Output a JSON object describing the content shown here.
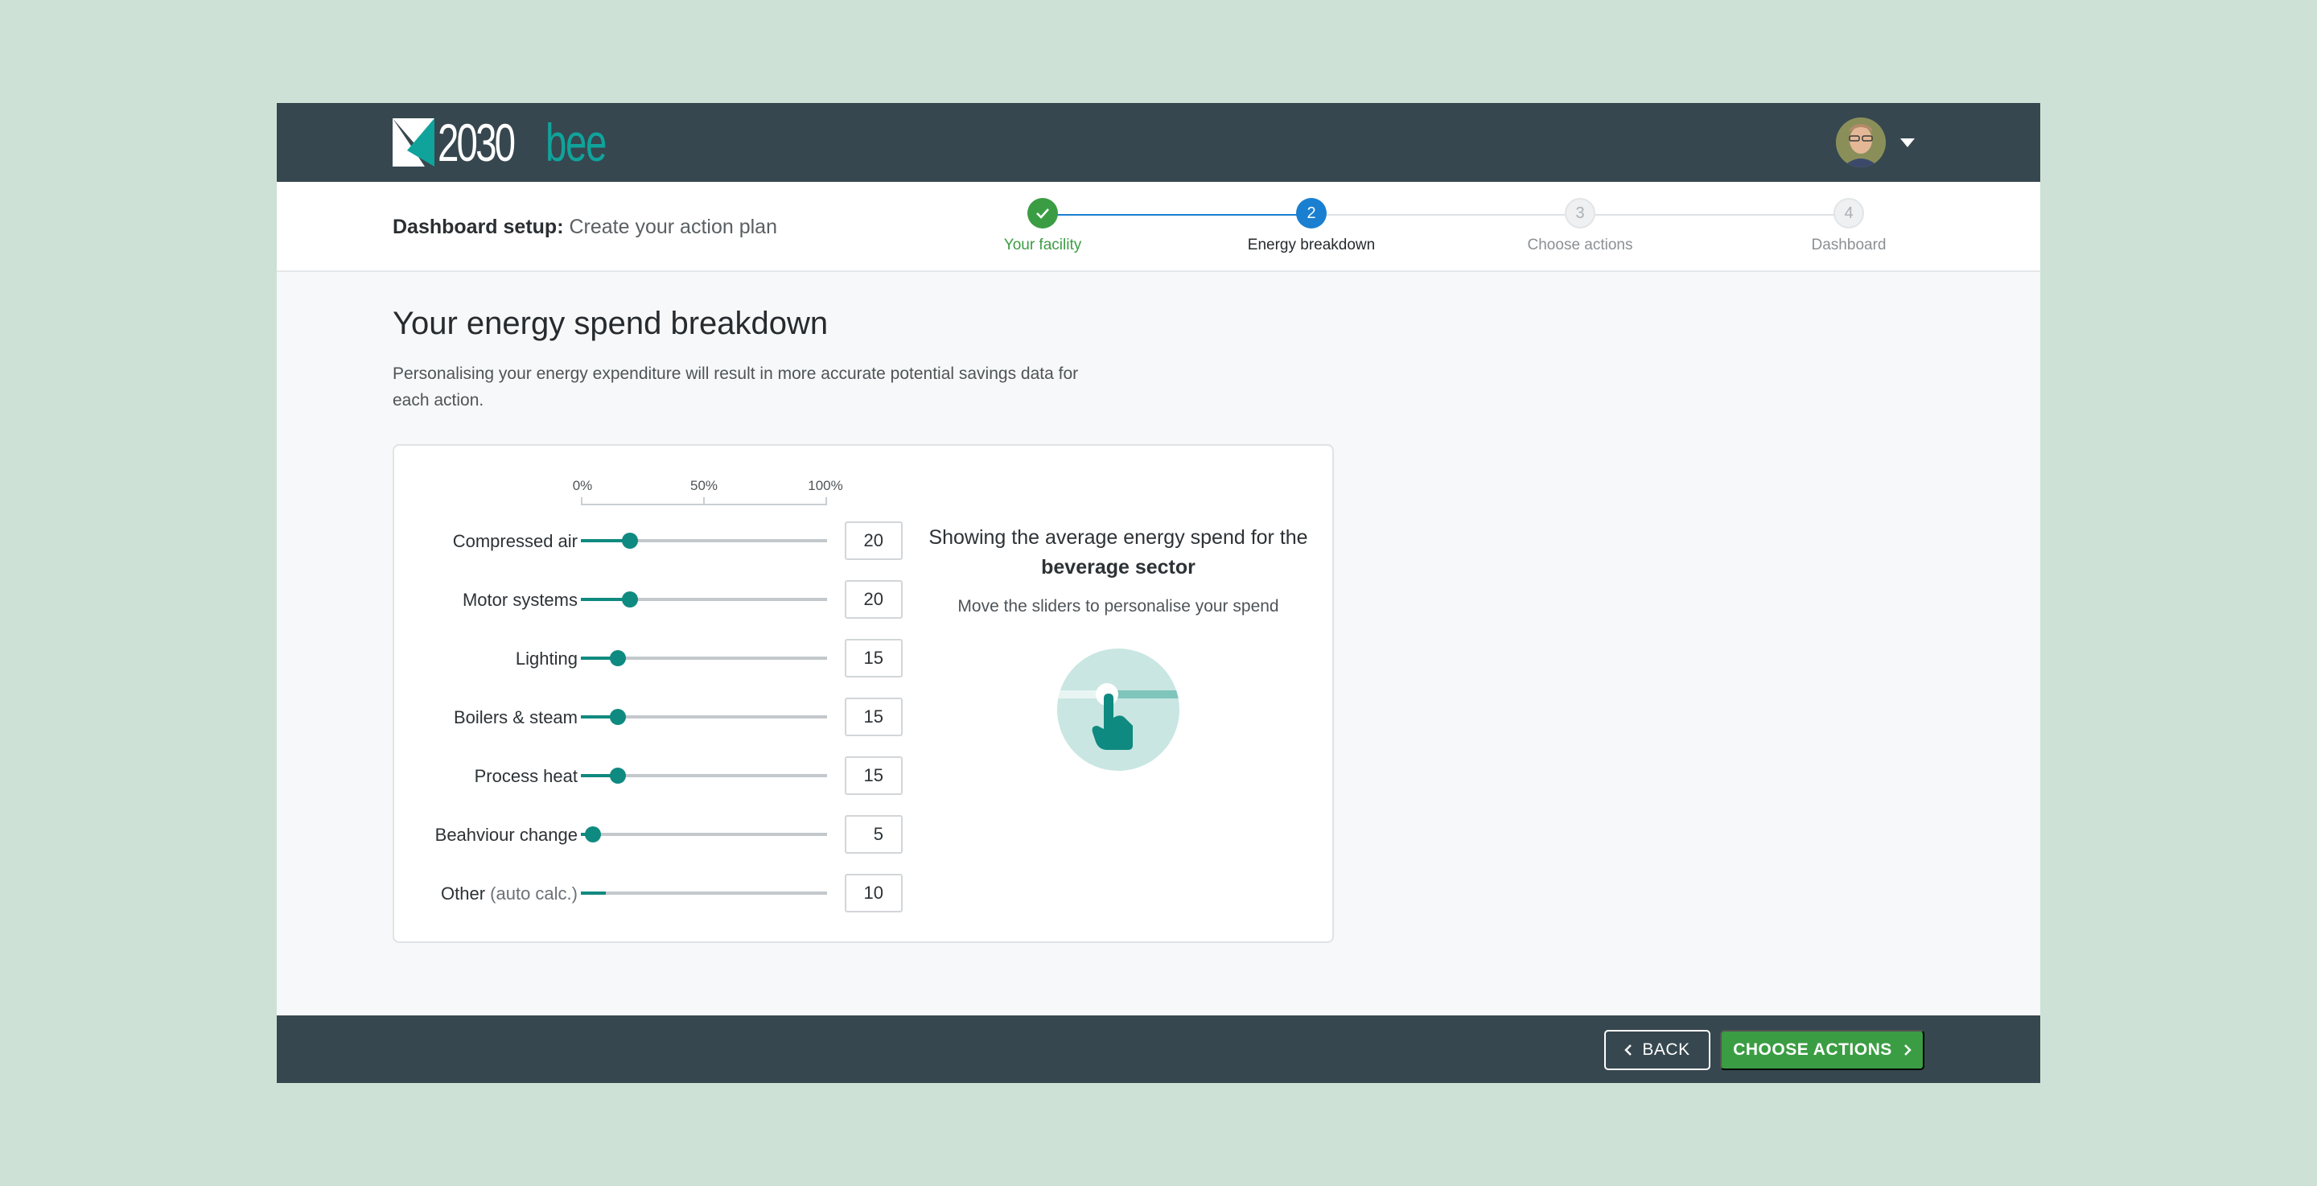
{
  "brand": {
    "num": "2030",
    "word": "bee",
    "accent": "#10a39b"
  },
  "header": {
    "avatar": "user-avatar",
    "menu_icon": "caret-down-icon"
  },
  "setup": {
    "bold": "Dashboard setup:",
    "rest": "Create your action plan"
  },
  "steps": [
    {
      "num": "",
      "label": "Your facility",
      "state": "done"
    },
    {
      "num": "2",
      "label": "Energy breakdown",
      "state": "active"
    },
    {
      "num": "3",
      "label": "Choose actions",
      "state": "todo"
    },
    {
      "num": "4",
      "label": "Dashboard",
      "state": "todo"
    }
  ],
  "main": {
    "title": "Your energy spend breakdown",
    "subtitle": "Personalising your energy expenditure will result in more accurate potential savings data for each action."
  },
  "scale": {
    "min": "0%",
    "mid": "50%",
    "max": "100%"
  },
  "rows": [
    {
      "label": "Compressed air",
      "suffix": "",
      "value": 20
    },
    {
      "label": "Motor systems",
      "suffix": "",
      "value": 20
    },
    {
      "label": "Lighting",
      "suffix": "",
      "value": 15
    },
    {
      "label": "Boilers & steam",
      "suffix": "",
      "value": 15
    },
    {
      "label": "Process heat",
      "suffix": "",
      "value": 15
    },
    {
      "label": "Beahviour change",
      "suffix": "",
      "value": 5
    },
    {
      "label": "Other",
      "suffix": "(auto calc.)",
      "value": 10
    }
  ],
  "info": {
    "line1": "Showing the average energy spend for the",
    "sector": "beverage sector",
    "hint": "Move the sliders to personalise your spend"
  },
  "footer": {
    "back": "BACK",
    "next": "CHOOSE ACTIONS"
  },
  "colors": {
    "topbar": "#36474f",
    "slider": "#0f8a80",
    "primary": "#3b9d43",
    "step_active": "#1a7fd0"
  }
}
